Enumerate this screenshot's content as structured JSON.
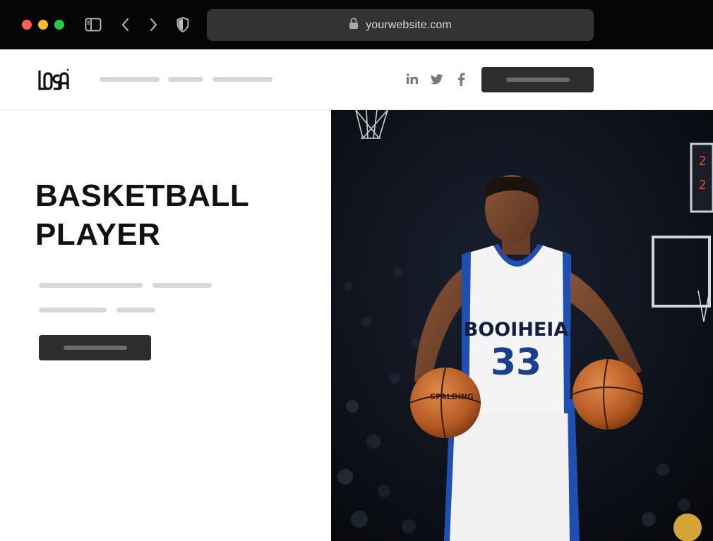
{
  "browser": {
    "url": "yourwebsite.com",
    "icons": [
      "sidebar-toggle-icon",
      "back-arrow-icon",
      "forward-arrow-icon",
      "shield-icon",
      "lock-icon"
    ]
  },
  "site": {
    "logo_text": "LOGO",
    "social_icons": [
      "linkedin-icon",
      "twitter-icon",
      "facebook-icon"
    ]
  },
  "hero": {
    "title_line_1": "BASKETBALL",
    "title_line_2": "PLAYER",
    "image": {
      "jersey_text": "BOOIHEIA",
      "jersey_number": "33",
      "ball_text": "SPALDING"
    }
  },
  "colors": {
    "chrome_bg": "#050505",
    "address_bar": "#333333",
    "button": "#2d2d2d",
    "placeholder": "#d7d7de",
    "jersey_blue": "#1f4fb0"
  }
}
